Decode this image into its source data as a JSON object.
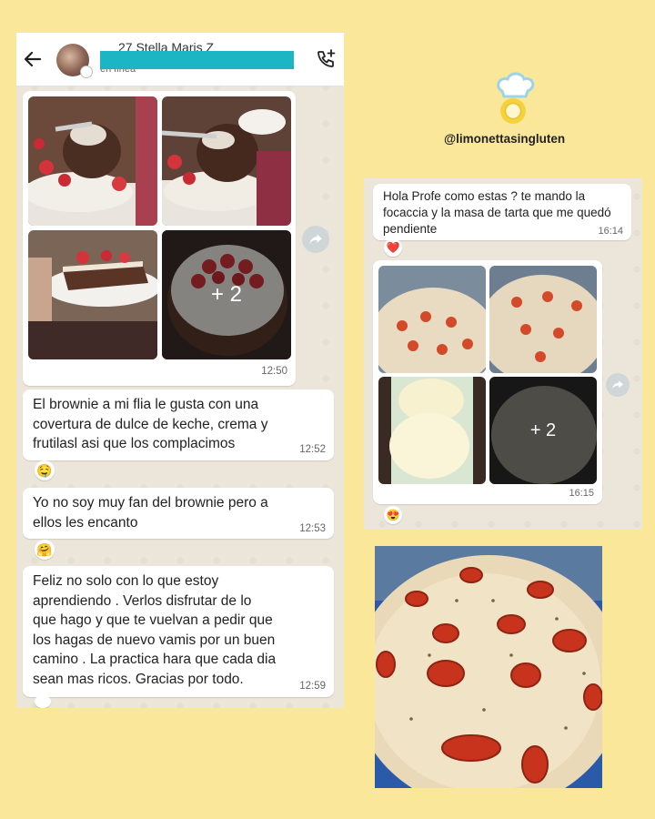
{
  "left_chat": {
    "header": {
      "contact_name": "27 Stella Maris Z",
      "status": "en línea"
    },
    "album": {
      "more_count": "+ 2",
      "time": "12:50"
    },
    "messages": [
      {
        "lines": [
          "El brownie a mi flia le gusta con una",
          "covertura  de dulce de keche, crema y",
          "frutilasl asi que los  complacimos"
        ],
        "time": "12:52",
        "reaction": "🤤"
      },
      {
        "lines": [
          "Yo no soy muy fan del brownie  pero a",
          "ellos les encanto"
        ],
        "time": "12:53",
        "reaction": "🤗"
      },
      {
        "lines": [
          "Feliz no solo con lo que estoy",
          "aprendiendo . Verlos  disfrutar   de lo",
          "que hago y que te vuelvan a pedir  que",
          "los hagas de nuevo  vamis por un buen",
          "camino . La practica hara que cada  dia",
          "sean mas ricos.  Gracias por todo."
        ],
        "time": "12:59"
      }
    ]
  },
  "right_chat": {
    "message": {
      "lines": [
        "Hola Profe como estas ? te mando la",
        "focaccia y la masa de tarta que me quedó",
        "pendiente"
      ],
      "time": "16:14",
      "reaction": "❤️"
    },
    "album": {
      "more_count": "+ 2",
      "time": "16:15",
      "reaction": "😍"
    }
  },
  "brand": {
    "handle": "@limonettasingluten"
  },
  "icons": {
    "back": "arrow-left-icon",
    "call": "add-call-icon",
    "forward": "forward-icon",
    "logo": "lemon-chef-hat-logo"
  },
  "colors": {
    "background": "#fbe79a",
    "chat_wallpaper": "#ece5d9",
    "bubble": "#ffffff",
    "redaction": "#1cb5c4",
    "brand_yellow": "#f4d23c",
    "brand_blue": "#9ed4e6"
  }
}
